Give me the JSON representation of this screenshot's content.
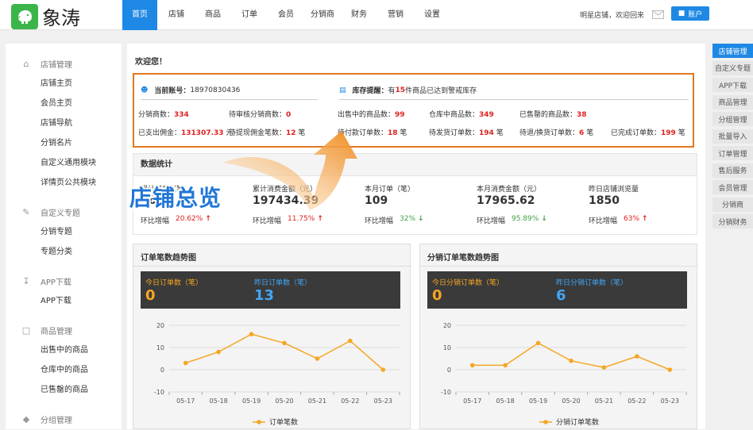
{
  "brand": {
    "name": "象涛"
  },
  "nav": {
    "items": [
      "首页",
      "店铺",
      "商品",
      "订单",
      "会员",
      "分销商",
      "财务",
      "营销",
      "设置"
    ]
  },
  "user": {
    "greeting": "明星店铺，欢迎回来",
    "account_label": "账户"
  },
  "sidebar": {
    "groups": [
      {
        "title": "店铺管理",
        "icon": "home-icon",
        "items": [
          "店铺主页",
          "会员主页",
          "店铺导航",
          "分销名片",
          "自定义通用模块",
          "详情页公共模块"
        ]
      },
      {
        "title": "自定义专题",
        "icon": "pencil-icon",
        "items": [
          "分销专题",
          "专题分类"
        ]
      },
      {
        "title": "APP下载",
        "icon": "download-icon",
        "items": [
          "APP下载"
        ]
      },
      {
        "title": "商品管理",
        "icon": "basket-icon",
        "items": [
          "出售中的商品",
          "仓库中的商品",
          "已售罄的商品"
        ]
      },
      {
        "title": "分组管理",
        "icon": "tag-icon",
        "items": []
      }
    ]
  },
  "rightbar": {
    "items": [
      "店铺管理",
      "自定义专题",
      "APP下载",
      "商品管理",
      "分组管理",
      "批量导入",
      "订单管理",
      "售后服务",
      "会员管理",
      "分销商",
      "分销财务"
    ]
  },
  "main": {
    "welcome": "欢迎您！",
    "account": {
      "label": "当前账号：",
      "value": "18970830436"
    },
    "stock": {
      "label": "库存提醒：",
      "prefix": "有",
      "count": "15",
      "suffix": "件商品已达到警戒库存"
    },
    "left_stats": [
      {
        "label": "分销商数：",
        "value": "334"
      },
      {
        "label": "待审核分销商数：",
        "value": "0"
      },
      {
        "label": "已支出佣金：",
        "value": "131307.33",
        "unit": "元"
      },
      {
        "label": "待提现佣金笔数：",
        "value": "12",
        "unit": "笔"
      }
    ],
    "right_stats": [
      {
        "label": "出售中的商品数：",
        "value": "99"
      },
      {
        "label": "仓库中商品数：",
        "value": "349"
      },
      {
        "label": "已售罄的商品数：",
        "value": "38"
      },
      {
        "label": "待付款订单数：",
        "value": "18",
        "unit": "笔"
      },
      {
        "label": "待发货订单数：",
        "value": "194",
        "unit": "笔"
      },
      {
        "label": "待退/换货订单数：",
        "value": "6",
        "unit": "笔"
      },
      {
        "label": "已完成订单数：",
        "value": "199",
        "unit": "笔"
      }
    ],
    "data_title": "数据统计",
    "kpis": [
      {
        "title": "累计订单（笔）",
        "value": "862",
        "change_label": "环比增幅",
        "change": "20.62%",
        "dir": "up"
      },
      {
        "title": "累计消费金额（元）",
        "value": "197434.39",
        "change_label": "环比增幅",
        "change": "11.75%",
        "dir": "up"
      },
      {
        "title": "本月订单（笔）",
        "value": "109",
        "change_label": "环比增幅",
        "change": "32%",
        "dir": "down"
      },
      {
        "title": "本月消费金额（元）",
        "value": "17965.62",
        "change_label": "环比增幅",
        "change": "95.89%",
        "dir": "down"
      },
      {
        "title": "昨日店铺浏览量",
        "value": "1850",
        "change_label": "环比增幅",
        "change": "63%",
        "dir": "up"
      }
    ],
    "overlay_text": "店铺总览"
  },
  "charts_ui": {
    "left": {
      "title": "订单笔数趋势图",
      "today_label": "今日订单数（笔）",
      "today_value": "0",
      "yday_label": "昨日订单数（笔）",
      "yday_value": "13"
    },
    "right": {
      "title": "分销订单笔数趋势图",
      "today_label": "今日分销订单数（笔）",
      "today_value": "0",
      "yday_label": "昨日分销订单数（笔）",
      "yday_value": "6"
    }
  },
  "colors": {
    "accent": "#1e88e5",
    "highlight_border": "#e07820",
    "line": "#f5a623",
    "up": "#e02020",
    "down": "#43a047"
  },
  "chart_data": [
    {
      "type": "line",
      "x": [
        "05-17",
        "05-18",
        "05-19",
        "05-20",
        "05-21",
        "05-22",
        "05-23"
      ],
      "series": [
        {
          "name": "订单笔数",
          "values": [
            3,
            8,
            16,
            12,
            5,
            13,
            0
          ]
        }
      ],
      "ylim": [
        -10,
        20
      ],
      "yticks": [
        -10,
        0,
        10,
        20
      ],
      "grid": true,
      "legend": "bottom"
    },
    {
      "type": "line",
      "x": [
        "05-17",
        "05-18",
        "05-19",
        "05-20",
        "05-21",
        "05-22",
        "05-23"
      ],
      "series": [
        {
          "name": "分销订单笔数",
          "values": [
            2,
            2,
            12,
            4,
            1,
            6,
            0
          ]
        }
      ],
      "ylim": [
        -10,
        20
      ],
      "yticks": [
        -10,
        0,
        10,
        20
      ],
      "grid": true,
      "legend": "bottom"
    }
  ]
}
